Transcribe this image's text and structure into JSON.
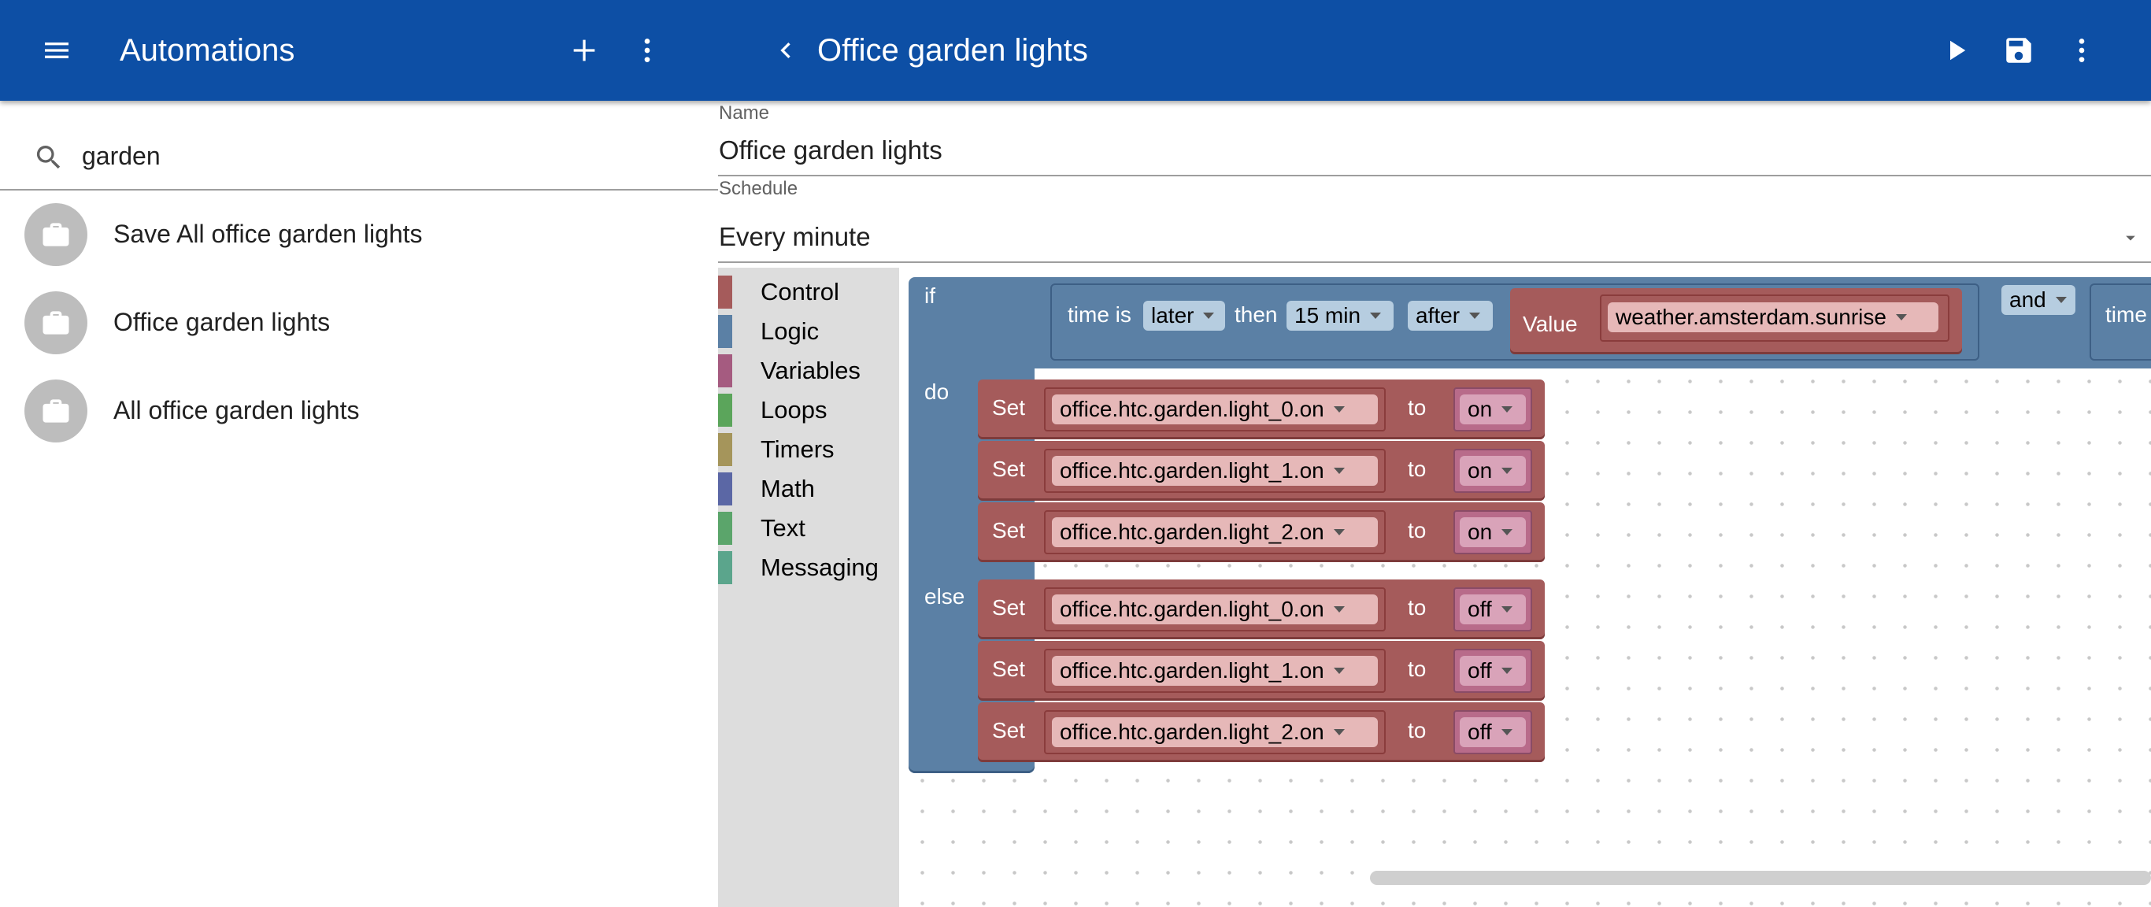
{
  "left_header": {
    "title": "Automations"
  },
  "search": {
    "value": "garden",
    "icon": "search-icon"
  },
  "automation_list": [
    {
      "label": "Save All office garden lights",
      "icon": "briefcase-icon"
    },
    {
      "label": "Office garden lights",
      "icon": "briefcase-icon"
    },
    {
      "label": "All office garden lights",
      "icon": "briefcase-icon"
    }
  ],
  "right_header": {
    "title": "Office garden lights"
  },
  "form": {
    "name_label": "Name",
    "name_value": "Office garden lights",
    "schedule_label": "Schedule",
    "schedule_value": "Every minute"
  },
  "toolbox": [
    {
      "name": "Control",
      "color": "#a55b5b"
    },
    {
      "name": "Logic",
      "color": "#5b80a5"
    },
    {
      "name": "Variables",
      "color": "#a55b80"
    },
    {
      "name": "Loops",
      "color": "#5ba55b"
    },
    {
      "name": "Timers",
      "color": "#a5955b"
    },
    {
      "name": "Math",
      "color": "#5b67a5"
    },
    {
      "name": "Text",
      "color": "#5ba56b"
    },
    {
      "name": "Messaging",
      "color": "#5ba58c"
    }
  ],
  "blocks": {
    "if_label": "if",
    "do_label": "do",
    "else_label": "else",
    "condition": {
      "time_is": "time is",
      "compare": "later",
      "then": "then",
      "offset": "15 min",
      "relation": "after",
      "value_label": "Value",
      "value": "weather.amsterdam.sunrise",
      "logic_op": "and",
      "next_time": "time"
    },
    "set_label": "Set",
    "to_label": "to",
    "do_rows": [
      {
        "target": "office.htc.garden.light_0.on",
        "value": "on"
      },
      {
        "target": "office.htc.garden.light_1.on",
        "value": "on"
      },
      {
        "target": "office.htc.garden.light_2.on",
        "value": "on"
      }
    ],
    "else_rows": [
      {
        "target": "office.htc.garden.light_0.on",
        "value": "off"
      },
      {
        "target": "office.htc.garden.light_1.on",
        "value": "off"
      },
      {
        "target": "office.htc.garden.light_2.on",
        "value": "off"
      }
    ]
  },
  "colors": {
    "app_bar": "#0d4fa5",
    "logic_block": "#5b80a5",
    "control_block": "#a55b5b",
    "variables_block": "#a55b80"
  }
}
